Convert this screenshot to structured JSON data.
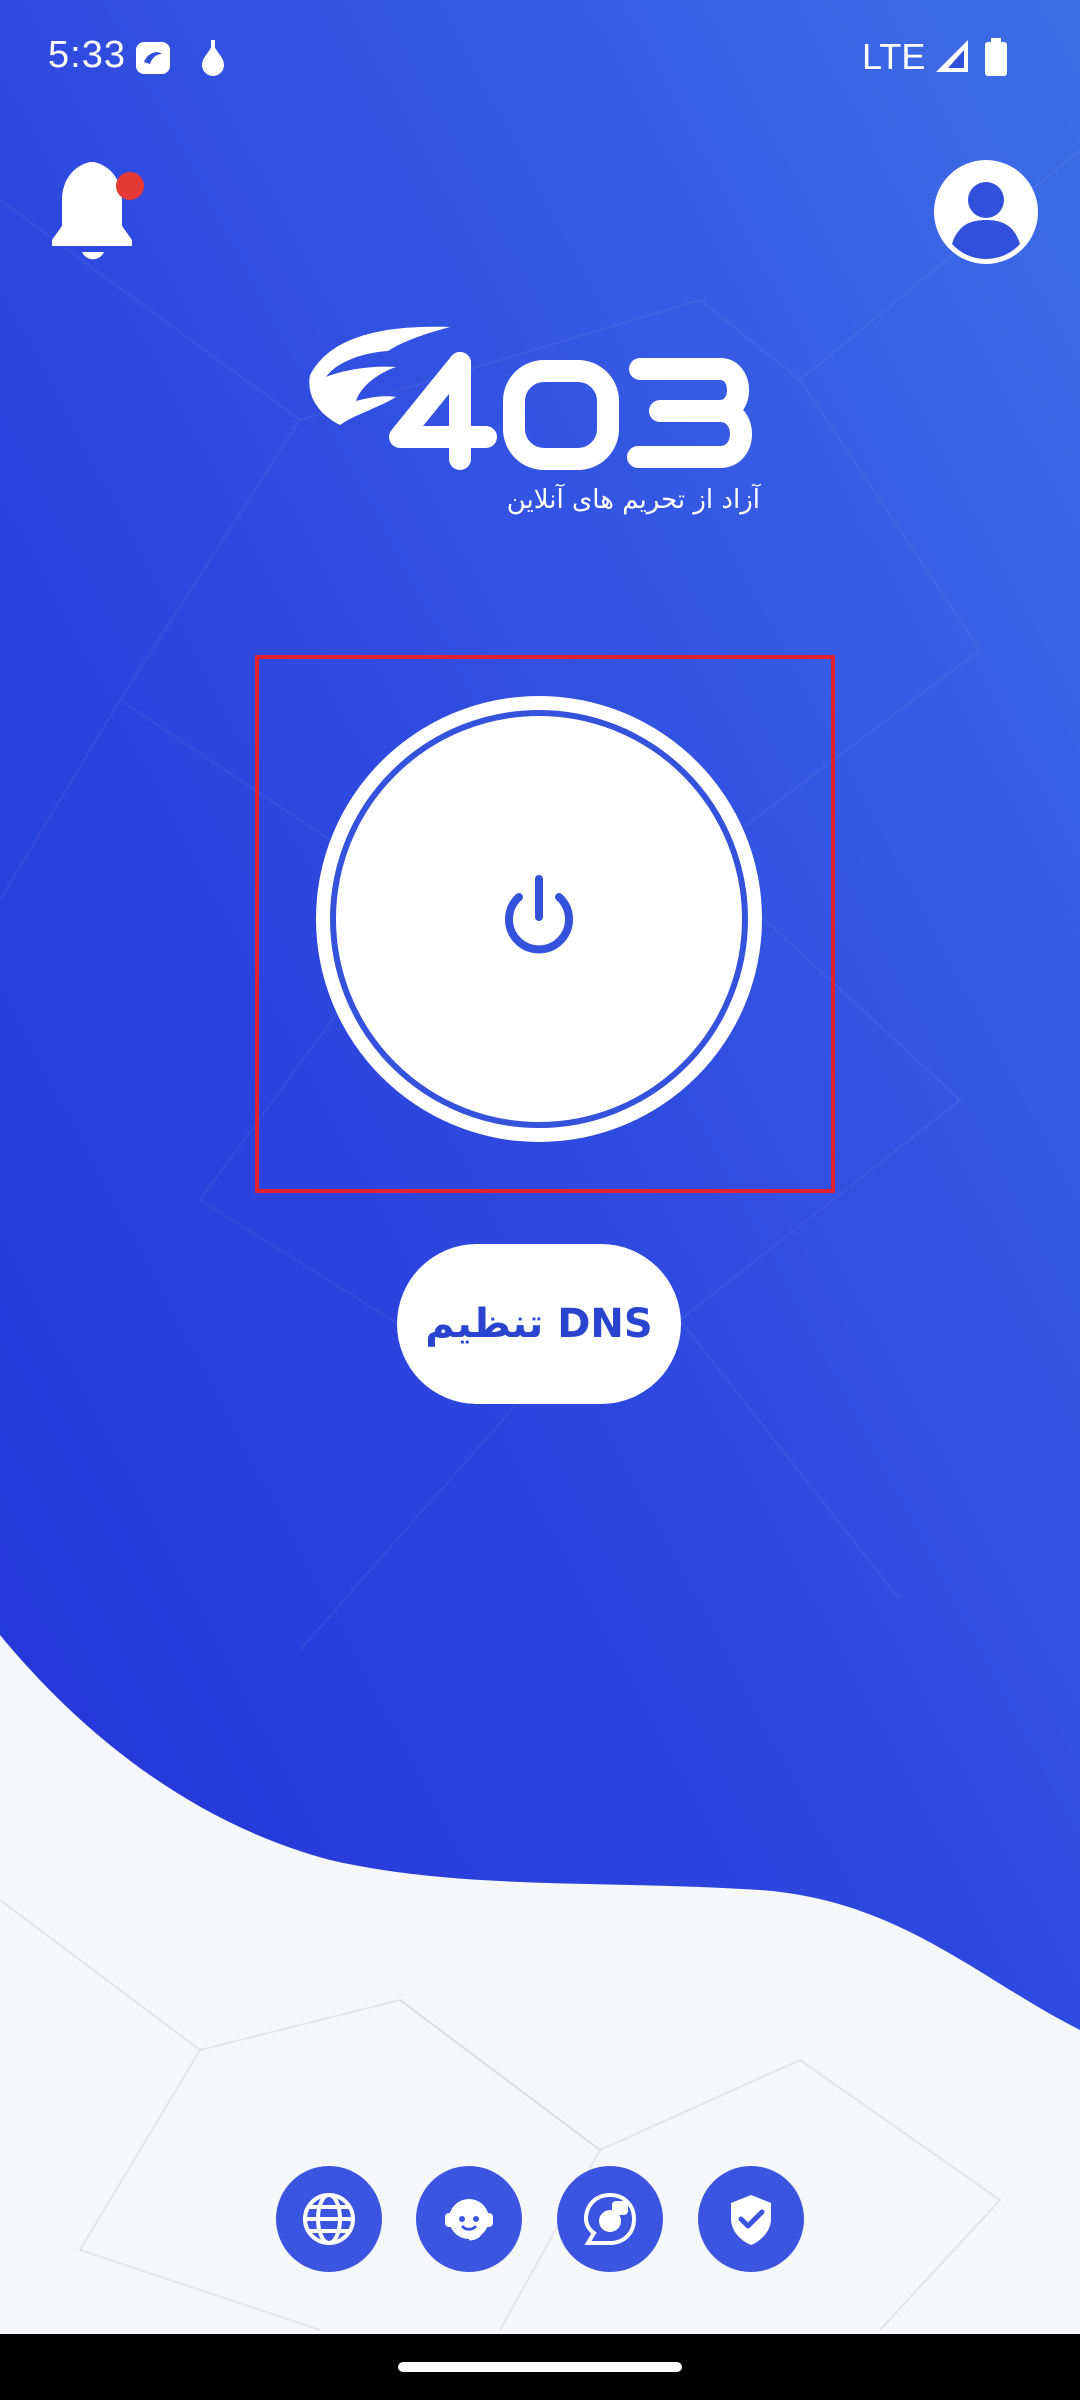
{
  "status_bar": {
    "time": "5:33",
    "network": "LTE",
    "icons": [
      "notification-app-icon",
      "drop-icon",
      "signal-icon",
      "battery-icon"
    ]
  },
  "header": {
    "bell_icon": "bell-icon",
    "bell_badge_color": "#e53935",
    "profile_icon": "user-profile-icon"
  },
  "logo": {
    "text": "403",
    "tagline": "آزاد از تحریم های آنلاین"
  },
  "power": {
    "icon": "power-icon"
  },
  "dns_button": {
    "label": "تنظیم DNS"
  },
  "bottom_nav": [
    {
      "name": "globe-icon"
    },
    {
      "name": "support-agent-icon"
    },
    {
      "name": "camera-app-icon"
    },
    {
      "name": "shield-check-icon"
    }
  ],
  "colors": {
    "primary_blue": "#2f47dc",
    "accent_blue": "#3b55e0",
    "white": "#ffffff",
    "highlight_red": "#e32030"
  }
}
